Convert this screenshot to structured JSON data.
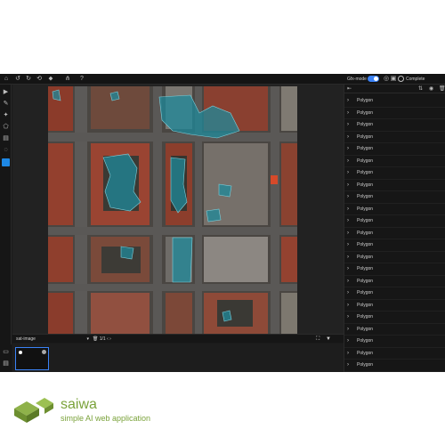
{
  "topbar": {
    "icons": [
      "home-icon",
      "undo-icon",
      "redo-icon",
      "history-icon",
      "tag-icon",
      "adjust-icon",
      "help-icon"
    ],
    "mode_label": "Gfx-mode",
    "toggle_on": true,
    "complete_label": "Complete"
  },
  "left_tools": [
    "pointer-icon",
    "pen-icon",
    "magic-wand-icon",
    "polygon-icon",
    "document-icon",
    "comment-icon",
    "color-swatch-icon"
  ],
  "accent_color": "#1e88e5",
  "polygon_color": "#1f8a9b",
  "bottom_bar": {
    "image_select": "sat-image",
    "page_text": "1/1"
  },
  "right_panel": {
    "header_icons": [
      "sort-icon",
      "eye-icon",
      "trash-icon"
    ],
    "layers": [
      "Polygon",
      "Polygon",
      "Polygon",
      "Polygon",
      "Polygon",
      "Polygon",
      "Polygon",
      "Polygon",
      "Polygon",
      "Polygon",
      "Polygon",
      "Polygon",
      "Polygon",
      "Polygon",
      "Polygon",
      "Polygon",
      "Polygon",
      "Polygon",
      "Polygon",
      "Polygon",
      "Polygon",
      "Polygon",
      "Polygon"
    ]
  },
  "brand": {
    "name": "saiwa",
    "tagline": "simple AI web application",
    "color": "#7aa23a"
  }
}
